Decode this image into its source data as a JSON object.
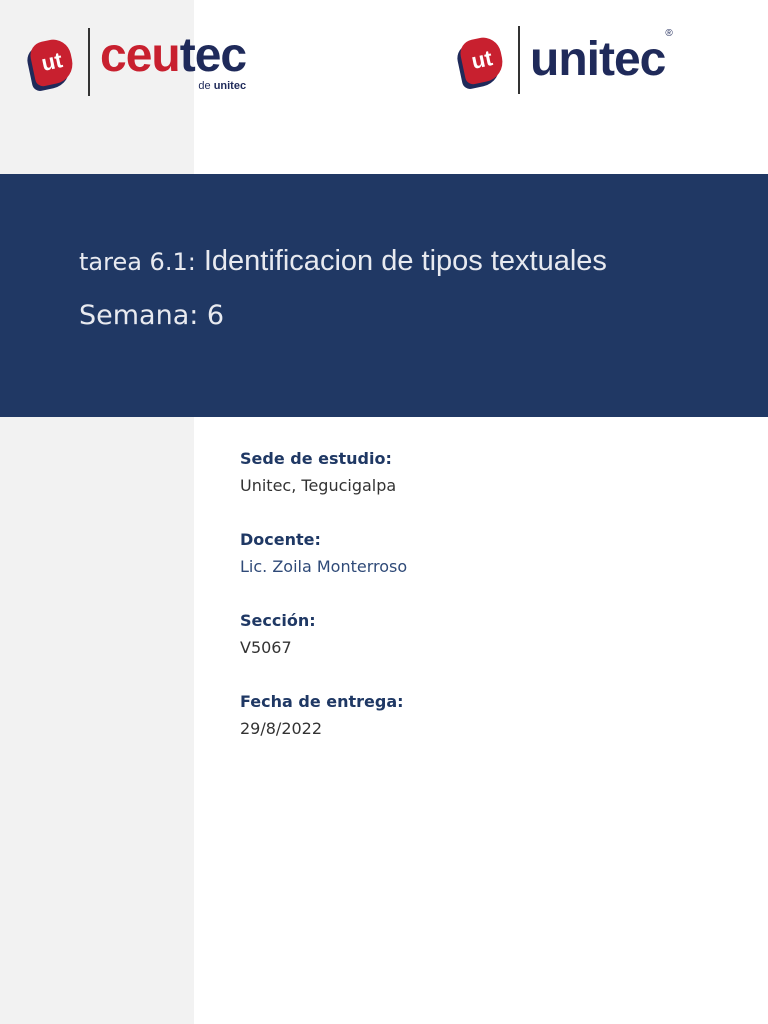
{
  "logos": {
    "left": {
      "mark": "ut",
      "word_red": "ceu",
      "word_blue": "tec",
      "sub_pre": "de ",
      "sub_bold": "unitec"
    },
    "right": {
      "mark": "ut",
      "word": "unitec",
      "registered": "®"
    }
  },
  "banner": {
    "title_prefix": "tarea 6.1:",
    "title_main": " Identificacion de tipos textuales",
    "week": "Semana: 6"
  },
  "fields": [
    {
      "label": "Sede de estudio:",
      "value": "Unitec, Tegucigalpa"
    },
    {
      "label": "Docente:",
      "value": "Lic. Zoila Monterroso"
    },
    {
      "label": "Sección:",
      "value": "V5067"
    },
    {
      "label": "Fecha de entrega:",
      "value": "29/8/2022"
    }
  ]
}
